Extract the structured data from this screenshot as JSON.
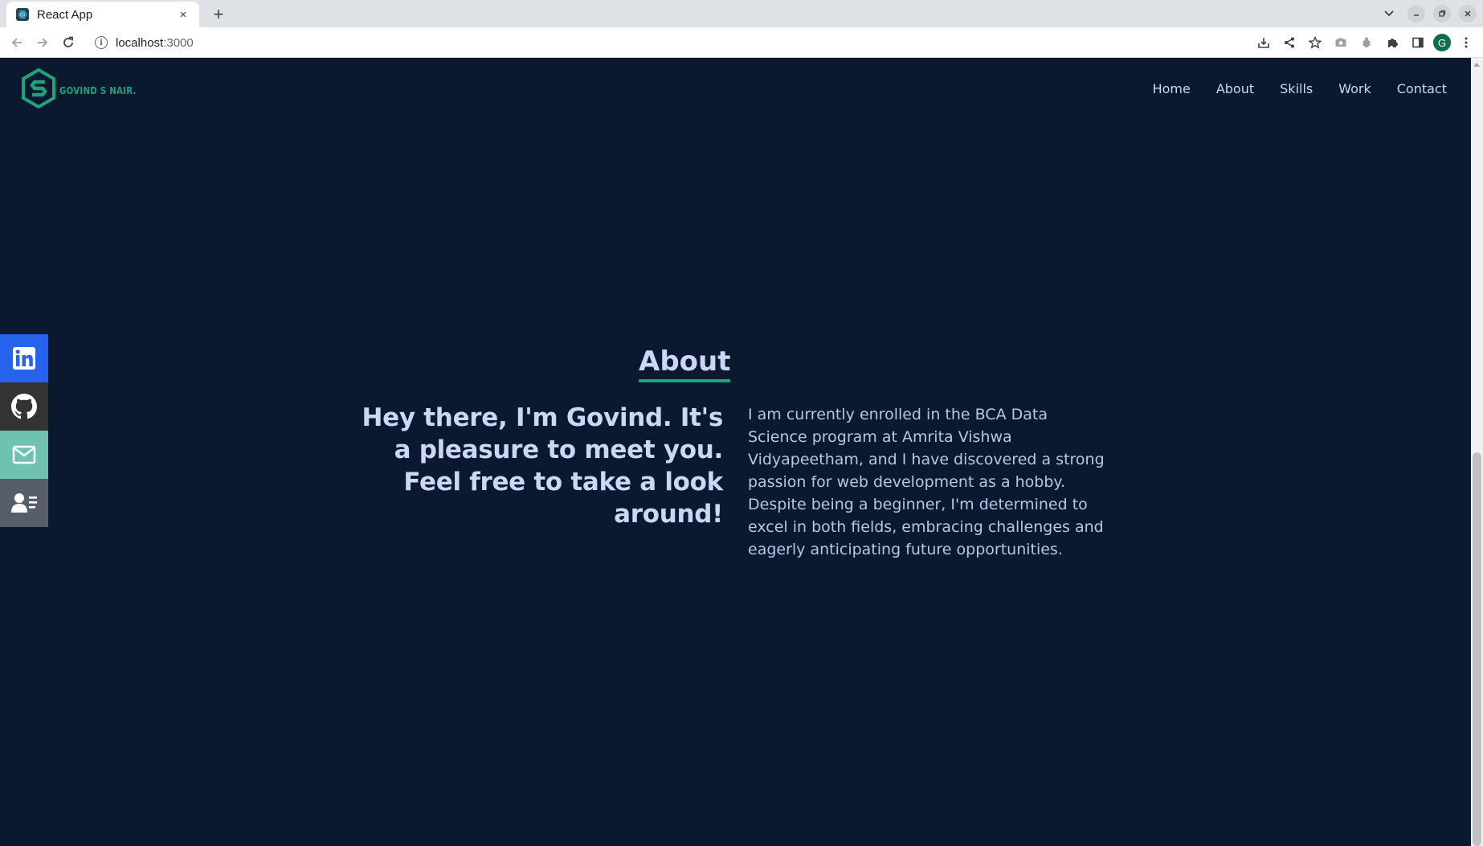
{
  "browser": {
    "tab_title": "React App",
    "tab_close": "×",
    "new_tab": "+",
    "url_host": "localhost",
    "url_port": ":3000",
    "profile_initial": "G"
  },
  "site": {
    "logo_text": "GOVIND S NAIR.",
    "nav": [
      "Home",
      "About",
      "Skills",
      "Work",
      "Contact"
    ],
    "social": [
      {
        "icon": "linkedin-icon",
        "color": "#2563eb"
      },
      {
        "icon": "github-icon",
        "color": "#333333"
      },
      {
        "icon": "mail-icon",
        "color": "#6fc2b0"
      },
      {
        "icon": "resume-icon",
        "color": "#565f69"
      }
    ]
  },
  "about": {
    "title": "About",
    "heading": "Hey there, I'm Govind. It's a pleasure to meet you. Feel free to take a look around!",
    "body": "I am currently enrolled in the BCA Data Science program at Amrita Vishwa Vidyapeetham, and I have discovered a strong passion for web development as a hobby. Despite being a beginner, I'm determined to excel in both fields, embracing challenges and eagerly anticipating future opportunities."
  },
  "colors": {
    "background": "#0a192f",
    "accent": "#1fa37c",
    "text": "#ccd6f6"
  }
}
